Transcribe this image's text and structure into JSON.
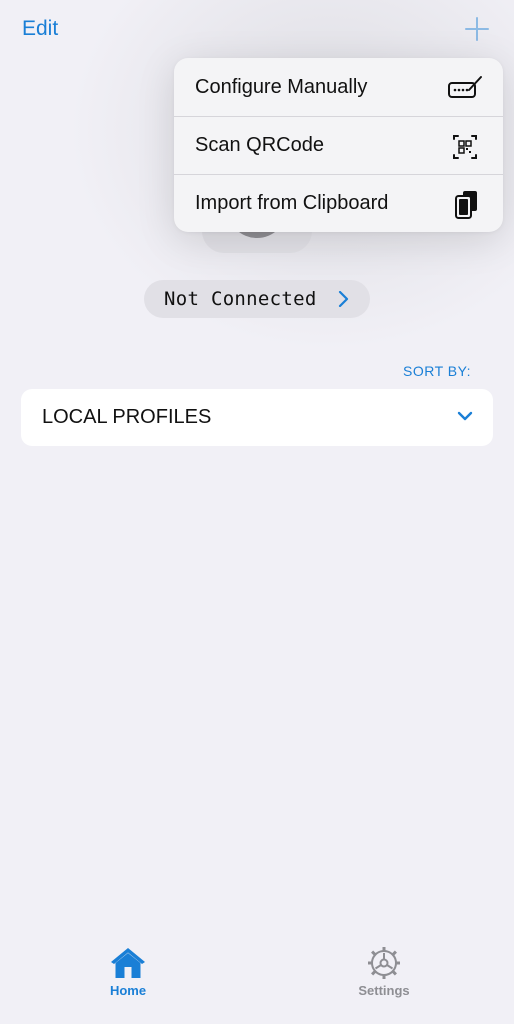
{
  "nav": {
    "edit_label": "Edit",
    "add_icon": "plus-icon"
  },
  "status": {
    "text": "Not Connected",
    "chevron_icon": "chevron-right-icon"
  },
  "sort": {
    "label": "SORT BY:"
  },
  "profiles": {
    "title": "LOCAL PROFILES",
    "chevron_icon": "chevron-down-icon"
  },
  "menu": {
    "items": [
      {
        "label": "Configure Manually",
        "icon": "pencil-keyboard-icon"
      },
      {
        "label": "Scan QRCode",
        "icon": "qr-scan-icon"
      },
      {
        "label": "Import from Clipboard",
        "icon": "clipboard-icon"
      }
    ]
  },
  "tabbar": {
    "tabs": [
      {
        "label": "Home",
        "icon": "house-icon",
        "selected": true
      },
      {
        "label": "Settings",
        "icon": "gear-icon",
        "selected": false
      }
    ]
  },
  "colors": {
    "accent": "#1a7fd6",
    "background": "#f1f0f6",
    "inactive": "#8e8e93"
  }
}
